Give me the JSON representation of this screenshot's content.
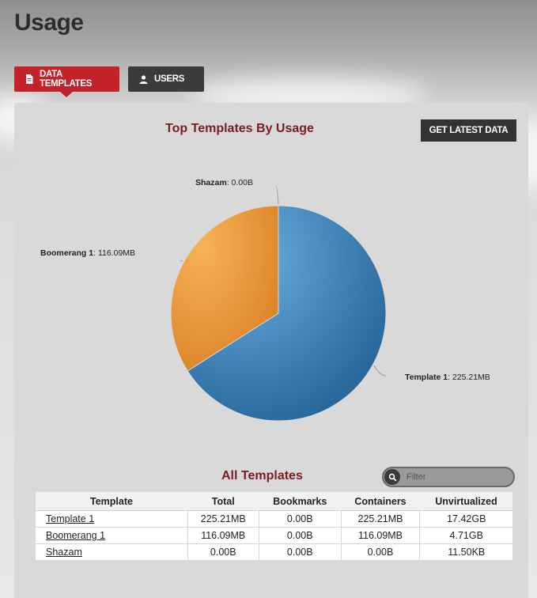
{
  "page": {
    "title": "Usage"
  },
  "tabs": [
    {
      "label": "DATA TEMPLATES",
      "icon": "document-icon",
      "active": true
    },
    {
      "label": "USERS",
      "icon": "user-icon",
      "active": false
    }
  ],
  "chart_section": {
    "get_latest_label": "GET LATEST DATA"
  },
  "chart_data": {
    "type": "pie",
    "title": "Top Templates By Usage",
    "slices": [
      {
        "name": "Template 1",
        "value": 225.21,
        "display": "225.21MB",
        "color": "#3a7db3"
      },
      {
        "name": "Boomerang 1",
        "value": 116.09,
        "display": "116.09MB",
        "color": "#e9953a"
      },
      {
        "name": "Shazam",
        "value": 0.0,
        "display": "0.00B",
        "color": "#888888"
      }
    ]
  },
  "table_section": {
    "title": "All Templates",
    "filter_placeholder": "Filter",
    "columns": [
      "Template",
      "Total",
      "Bookmarks",
      "Containers",
      "Unvirtualized"
    ],
    "rows": [
      [
        "Template 1",
        "225.21MB",
        "0.00B",
        "225.21MB",
        "17.42GB"
      ],
      [
        "Boomerang 1",
        "116.09MB",
        "0.00B",
        "116.09MB",
        "4.71GB"
      ],
      [
        "Shazam",
        "0.00B",
        "0.00B",
        "0.00B",
        "11.50KB"
      ]
    ]
  }
}
